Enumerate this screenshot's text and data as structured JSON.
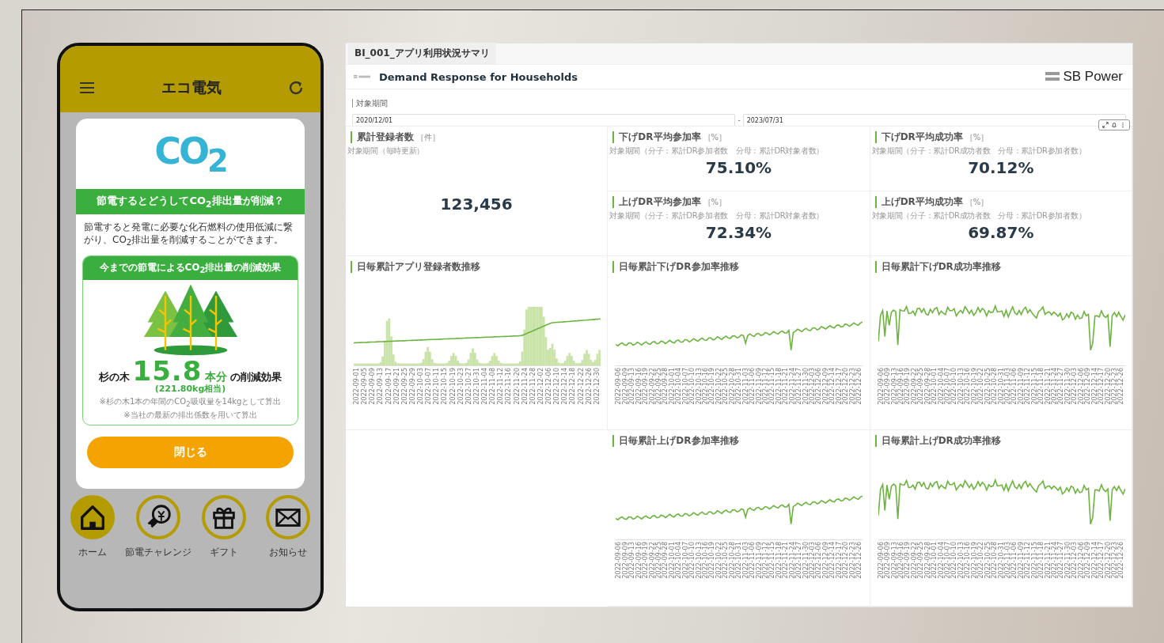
{
  "phone": {
    "title": "エコ電気",
    "modal": {
      "logo": "CO$_{2}$",
      "heading": "節電するとどうしてCO$_{2}$排出量が削減？",
      "body": "節電すると発電に必要な化石燃料の使用低減に繋がり、CO$_{2}$排出量を削減することができます。",
      "effect": {
        "heading": "今までの節電によるCO$_{2}$排出量の削減効果",
        "prefix": "杉の木",
        "number": "15.8",
        "unit": "本分",
        "suffix": "の削減効果",
        "equivalent": "(221.80kg相当)",
        "notes": [
          "※杉の木1本の年間のCO$_{2}$吸収量を14kgとして算出",
          "※当社の最新の排出係数を用いて算出"
        ]
      },
      "button": "閉じる"
    },
    "nav": [
      {
        "kind": "home",
        "label": "ホーム",
        "selected": true
      },
      {
        "kind": "challenge",
        "label": "節電チャレンジ",
        "selected": false
      },
      {
        "kind": "gift",
        "label": "ギフト",
        "selected": false
      },
      {
        "kind": "mail",
        "label": "お知らせ",
        "selected": false
      }
    ]
  },
  "dashboard": {
    "tab": "BI_001_アプリ利用状況サマリ",
    "title": "Demand Response for Households",
    "brand": "SB Power",
    "filter": {
      "label": "対象期間",
      "from": "2020/12/01",
      "separator": "-",
      "to": "2023/07/31"
    },
    "kpis": [
      {
        "kind": "tall",
        "title": "累計登録者数",
        "unit": "［件］",
        "note": "対象期間（毎時更新）",
        "value": "123,456"
      },
      {
        "kind": "small",
        "title": "下げDR平均参加率",
        "unit": "［%］",
        "note": "対象期間（分子：累計DR参加者数　分母：累計DR対象者数）",
        "value": "75.10%"
      },
      {
        "kind": "small",
        "title": "下げDR平均成功率",
        "unit": "［%］",
        "note": "対象期間（分子：累計DR成功者数　分母：累計DR参加者数）",
        "value": "70.12%"
      },
      {
        "kind": "small",
        "title": "上げDR平均参加率",
        "unit": "［%］",
        "note": "対象期間（分子：累計DR参加者数　分母：累計DR対象者数）",
        "value": "72.34%"
      },
      {
        "kind": "small",
        "title": "上げDR平均成功率",
        "unit": "［%］",
        "note": "対象期間（分子：累計DR成功者数　分母：累計DR参加者数）",
        "value": "69.87%"
      }
    ],
    "charts": [
      {
        "kind": "bar_line",
        "title": "日毎累計アプリ登録者数推移",
        "x_labels": [
          "2022-09-01",
          "2022-09-05",
          "2022-09-09",
          "2022-09-13",
          "2022-09-17",
          "2022-09-21",
          "2022-09-25",
          "2022-09-29",
          "2022-10-03",
          "2022-10-07",
          "2022-10-11",
          "2022-10-15",
          "2022-10-19",
          "2022-10-23",
          "2022-10-27",
          "2022-10-31",
          "2022-11-04",
          "2022-11-08",
          "2022-11-12",
          "2022-11-16",
          "2022-11-20",
          "2022-11-24",
          "2022-11-28",
          "2022-12-02",
          "2022-12-06",
          "2022-12-10",
          "2022-12-14",
          "2022-12-18",
          "2022-12-22",
          "2022-12-26",
          "2022-12-30"
        ]
      },
      {
        "kind": "trend",
        "title": "日毎累計下げDR参加率推移",
        "x_labels": [
          "2022-09-06",
          "2022-09-09",
          "2022-09-13",
          "2022-09-16",
          "2022-09-19",
          "2022-09-22",
          "2022-09-25",
          "2022-09-28",
          "2022-10-01",
          "2022-10-04",
          "2022-10-07",
          "2022-10-10",
          "2022-10-13",
          "2022-10-16",
          "2022-10-19",
          "2022-10-22",
          "2022-10-25",
          "2022-10-28",
          "2022-10-31",
          "2022-11-03",
          "2022-11-06",
          "2022-11-09",
          "2022-11-12",
          "2022-11-15",
          "2022-11-18",
          "2022-11-21",
          "2022-11-24",
          "2022-11-27",
          "2022-11-30",
          "2022-12-03",
          "2022-12-06",
          "2022-12-09",
          "2022-12-14",
          "2022-12-17",
          "2022-12-20",
          "2022-12-23",
          "2022-12-26"
        ]
      },
      {
        "kind": "jagged",
        "title": "日毎累計下げDR成功率推移",
        "x_labels": [
          "2022-09-06",
          "2022-09-09",
          "2022-09-13",
          "2022-09-16",
          "2022-09-19",
          "2022-09-22",
          "2022-09-25",
          "2022-09-28",
          "2022-10-01",
          "2022-10-04",
          "2022-10-07",
          "2022-10-10",
          "2022-10-13",
          "2022-10-16",
          "2022-10-19",
          "2022-10-22",
          "2022-10-25",
          "2022-10-28",
          "2022-10-31",
          "2022-11-03",
          "2022-11-06",
          "2022-11-09",
          "2022-11-12",
          "2022-11-15",
          "2022-11-18",
          "2022-11-21",
          "2022-11-24",
          "2022-11-27",
          "2022-11-30",
          "2022-12-03",
          "2022-12-06",
          "2022-12-09",
          "2022-12-14",
          "2022-12-17",
          "2022-12-20",
          "2022-12-23",
          "2022-12-26"
        ]
      },
      {
        "kind": "trend",
        "title": "日毎累計上げDR参加率推移",
        "x_labels": [
          "2022-09-06",
          "2022-09-09",
          "2022-09-13",
          "2022-09-16",
          "2022-09-19",
          "2022-09-22",
          "2022-09-25",
          "2022-09-28",
          "2022-10-01",
          "2022-10-04",
          "2022-10-07",
          "2022-10-10",
          "2022-10-13",
          "2022-10-16",
          "2022-10-19",
          "2022-10-22",
          "2022-10-25",
          "2022-10-28",
          "2022-10-31",
          "2022-11-03",
          "2022-11-06",
          "2022-11-09",
          "2022-11-12",
          "2022-11-15",
          "2022-11-18",
          "2022-11-21",
          "2022-11-24",
          "2022-11-27",
          "2022-11-30",
          "2022-12-03",
          "2022-12-06",
          "2022-12-09",
          "2022-12-14",
          "2022-12-17",
          "2022-12-20",
          "2022-12-23",
          "2022-12-26"
        ]
      },
      {
        "kind": "jagged",
        "title": "日毎累計上げDR成功率推移",
        "x_labels": [
          "2022-09-06",
          "2022-09-09",
          "2022-09-13",
          "2022-09-16",
          "2022-09-19",
          "2022-09-22",
          "2022-09-25",
          "2022-09-28",
          "2022-10-01",
          "2022-10-04",
          "2022-10-07",
          "2022-10-10",
          "2022-10-13",
          "2022-10-16",
          "2022-10-19",
          "2022-10-22",
          "2022-10-25",
          "2022-10-28",
          "2022-10-31",
          "2022-11-03",
          "2022-11-06",
          "2022-11-09",
          "2022-11-12",
          "2022-11-15",
          "2022-11-18",
          "2022-11-21",
          "2022-11-24",
          "2022-11-27",
          "2022-11-30",
          "2022-12-03",
          "2022-12-06",
          "2022-12-09",
          "2022-12-14",
          "2022-12-17",
          "2022-12-20",
          "2022-12-23",
          "2022-12-26"
        ]
      }
    ]
  }
}
